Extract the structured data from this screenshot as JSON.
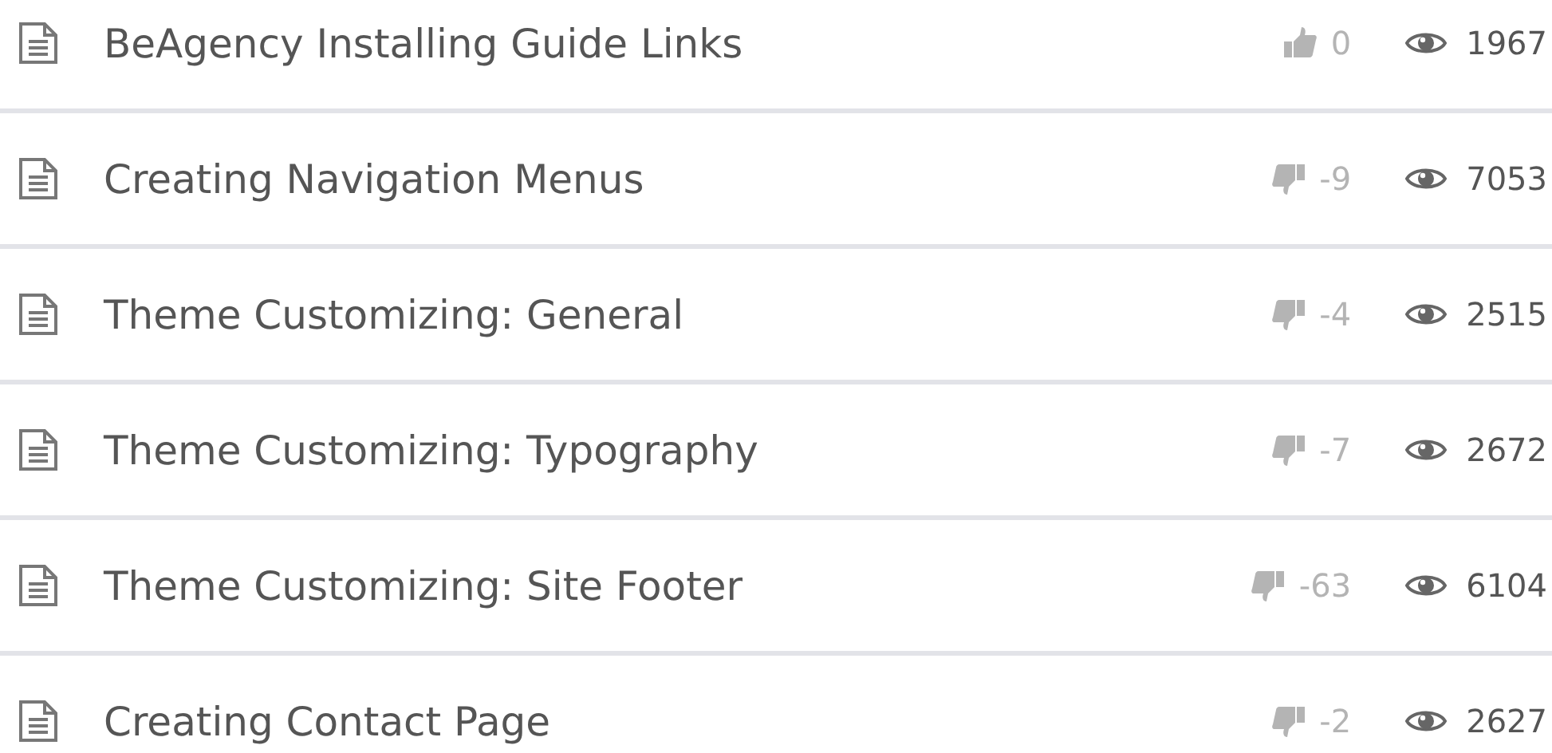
{
  "articles": [
    {
      "title": "BeAgency Installing Guide Links",
      "vote": {
        "kind": "up",
        "count": "0"
      },
      "views": "1967"
    },
    {
      "title": "Creating Navigation Menus",
      "vote": {
        "kind": "down",
        "count": "-9"
      },
      "views": "7053"
    },
    {
      "title": "Theme Customizing: General",
      "vote": {
        "kind": "down",
        "count": "-4"
      },
      "views": "2515"
    },
    {
      "title": "Theme Customizing: Typography",
      "vote": {
        "kind": "down",
        "count": "-7"
      },
      "views": "2672"
    },
    {
      "title": "Theme Customizing: Site Footer",
      "vote": {
        "kind": "down",
        "count": "-63"
      },
      "views": "6104"
    },
    {
      "title": "Creating Contact Page",
      "vote": {
        "kind": "down",
        "count": "-2"
      },
      "views": "2627"
    }
  ]
}
